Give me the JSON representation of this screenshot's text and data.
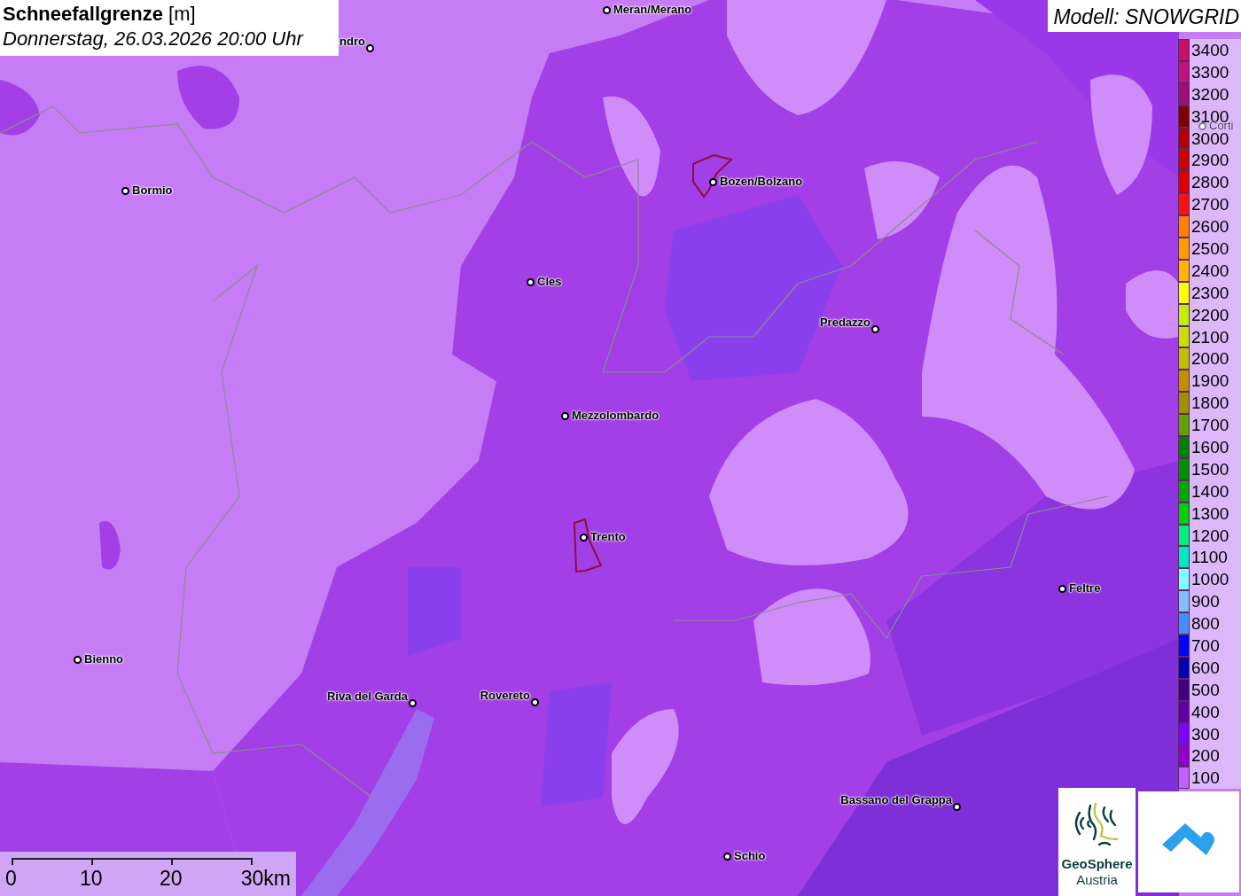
{
  "title": {
    "heading": "**Schneefallgrenze** [m]",
    "datetime": "Donnerstag, 26.03.2026 20:00 Uhr"
  },
  "model_label": "Modell: SNOWGRID",
  "legend": [
    {
      "label": "3400",
      "color": "#c8106a"
    },
    {
      "label": "3300",
      "color": "#c0127c"
    },
    {
      "label": "3200",
      "color": "#a00e78"
    },
    {
      "label": "3100",
      "color": "#800000"
    },
    {
      "label": "3000",
      "color": "#b00000"
    },
    {
      "label": "2900",
      "color": "#c80000"
    },
    {
      "label": "2800",
      "color": "#e00000"
    },
    {
      "label": "2700",
      "color": "#ff1010"
    },
    {
      "label": "2600",
      "color": "#ff8000"
    },
    {
      "label": "2500",
      "color": "#ff9a00"
    },
    {
      "label": "2400",
      "color": "#ffb400"
    },
    {
      "label": "2300",
      "color": "#ffff00"
    },
    {
      "label": "2200",
      "color": "#c0f000"
    },
    {
      "label": "2100",
      "color": "#c8e000"
    },
    {
      "label": "2000",
      "color": "#c0c000"
    },
    {
      "label": "1900",
      "color": "#c09000"
    },
    {
      "label": "1800",
      "color": "#a09000"
    },
    {
      "label": "1700",
      "color": "#60a000"
    },
    {
      "label": "1600",
      "color": "#008000"
    },
    {
      "label": "1500",
      "color": "#009000"
    },
    {
      "label": "1400",
      "color": "#00a800"
    },
    {
      "label": "1300",
      "color": "#00d000"
    },
    {
      "label": "1200",
      "color": "#00f080"
    },
    {
      "label": "1100",
      "color": "#00e8c0"
    },
    {
      "label": "1000",
      "color": "#80ffff"
    },
    {
      "label": "900",
      "color": "#80c0ff"
    },
    {
      "label": "800",
      "color": "#4090ff"
    },
    {
      "label": "700",
      "color": "#0000ff"
    },
    {
      "label": "600",
      "color": "#0000b0"
    },
    {
      "label": "500",
      "color": "#400080"
    },
    {
      "label": "400",
      "color": "#6000a0"
    },
    {
      "label": "300",
      "color": "#8000ff"
    },
    {
      "label": "200",
      "color": "#9000d0"
    },
    {
      "label": "100",
      "color": "#c060ff"
    }
  ],
  "places": [
    {
      "name": "ndro"
    },
    {
      "name": "Meran/Merano"
    },
    {
      "name": "Bormio"
    },
    {
      "name": "Bozen/Bolzano"
    },
    {
      "name": "Cles"
    },
    {
      "name": "Predazzo"
    },
    {
      "name": "Mezzolombardo"
    },
    {
      "name": "Trento"
    },
    {
      "name": "Feltre"
    },
    {
      "name": "Bienno"
    },
    {
      "name": "Riva del Garda"
    },
    {
      "name": "Rovereto"
    },
    {
      "name": "Bassano del Grappa"
    },
    {
      "name": "Schio"
    },
    {
      "name": "Corti"
    }
  ],
  "scale_bar": {
    "labels": [
      "0",
      "10",
      "20",
      "30km"
    ]
  },
  "logo": {
    "name": "GeoSphere",
    "subtitle": "Austria"
  }
}
